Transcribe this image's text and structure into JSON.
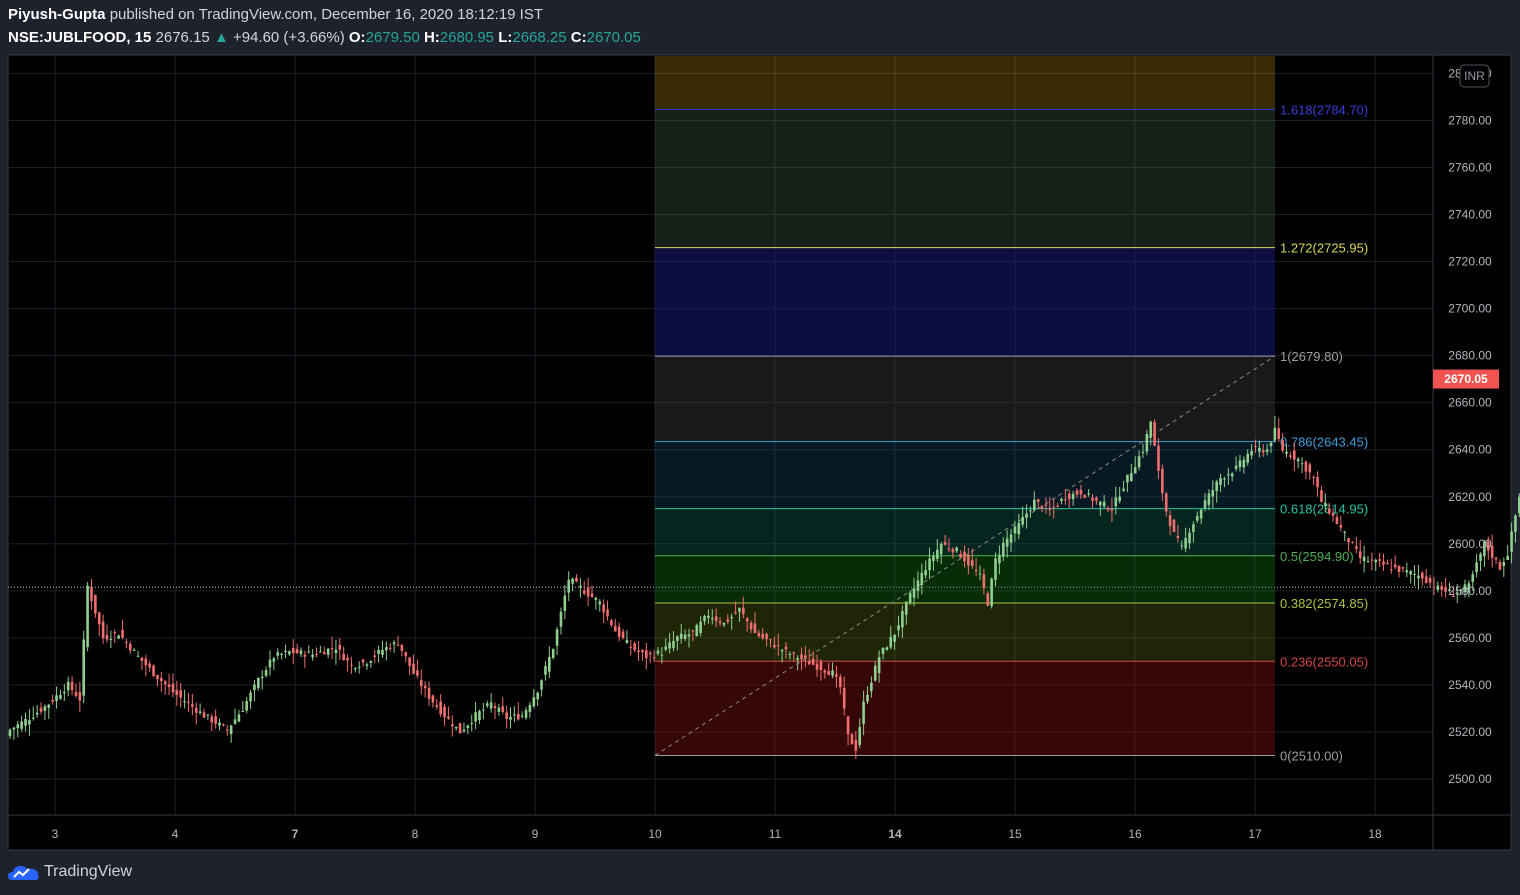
{
  "header": {
    "author": "Piyush-Gupta",
    "published_text": "published on TradingView.com, December 16, 2020 18:12:19 IST",
    "symbol": "NSE:JUBLFOOD, 15",
    "last": "2676.15",
    "change": "+94.60 (+3.66%)",
    "o_label": "O:",
    "o_value": "2679.50",
    "h_label": "H:",
    "h_value": "2680.95",
    "l_label": "L:",
    "l_value": "2668.25",
    "c_label": "C:",
    "c_value": "2670.05"
  },
  "currency_badge": "INR",
  "price_badge": "2670.05",
  "footer": {
    "brand": "TradingView"
  },
  "colors": {
    "up": "#26a69a",
    "down": "#ef5350",
    "upCandle": "#8fcf8f",
    "downCandle": "#f06e6e",
    "price_badge": "#f05350"
  },
  "chart_data": {
    "type": "candlestick",
    "title": "NSE:JUBLFOOD, 15",
    "xlabel": "",
    "ylabel": "",
    "ylim": [
      2490,
      2810
    ],
    "x_ticks": [
      "3",
      "4",
      "7",
      "8",
      "9",
      "10",
      "11",
      "14",
      "15",
      "16",
      "17",
      "18"
    ],
    "y_ticks": [
      "2500.00",
      "2520.00",
      "2540.00",
      "2560.00",
      "2580.00",
      "2600.00",
      "2620.00",
      "2640.00",
      "2660.00",
      "2680.00",
      "2700.00",
      "2720.00",
      "2740.00",
      "2760.00",
      "2780.00",
      "2800.00"
    ],
    "last_price": 2670.05,
    "prev_close_line": 2581.5,
    "grid": true,
    "fibonacci": {
      "from": {
        "x": "10",
        "y": 2510.0
      },
      "to": {
        "x": "17",
        "y": 2679.8
      },
      "levels": [
        {
          "ratio": "1.618",
          "price": "2784.70",
          "label": "1.618(2784.70)",
          "color": "#3b3bd9"
        },
        {
          "ratio": "1.272",
          "price": "2725.95",
          "label": "1.272(2725.95)",
          "color": "#d6d95a"
        },
        {
          "ratio": "1",
          "price": "2679.80",
          "label": "1(2679.80)",
          "color": "#9e9e9e"
        },
        {
          "ratio": "0.786",
          "price": "2643.45",
          "label": "0.786(2643.45)",
          "color": "#3c9fd9"
        },
        {
          "ratio": "0.618",
          "price": "2614.95",
          "label": "0.618(2614.95)",
          "color": "#27c4a3"
        },
        {
          "ratio": "0.5",
          "price": "2594.90",
          "label": "0.5(2594.90)",
          "color": "#4caf50"
        },
        {
          "ratio": "0.382",
          "price": "2574.85",
          "label": "0.382(2574.85)",
          "color": "#b0c23c"
        },
        {
          "ratio": "0.236",
          "price": "2550.05",
          "label": "0.236(2550.05)",
          "color": "#d34545"
        },
        {
          "ratio": "0",
          "price": "2510.00",
          "label": "0(2510.00)",
          "color": "#9e9e9e"
        }
      ]
    },
    "close_path": [
      [
        0,
        2521
      ],
      [
        5,
        2526
      ],
      [
        10,
        2532
      ],
      [
        15,
        2540
      ],
      [
        18,
        2534
      ],
      [
        20,
        2582
      ],
      [
        24,
        2560
      ],
      [
        28,
        2562
      ],
      [
        33,
        2552
      ],
      [
        37,
        2545
      ],
      [
        42,
        2537
      ],
      [
        46,
        2532
      ],
      [
        50,
        2527
      ],
      [
        56,
        2521
      ],
      [
        60,
        2530
      ],
      [
        64,
        2542
      ],
      [
        68,
        2552
      ],
      [
        72,
        2554
      ],
      [
        78,
        2553
      ],
      [
        84,
        2556
      ],
      [
        88,
        2548
      ],
      [
        92,
        2550
      ],
      [
        96,
        2555
      ],
      [
        100,
        2558
      ],
      [
        104,
        2545
      ],
      [
        108,
        2535
      ],
      [
        112,
        2527
      ],
      [
        116,
        2520
      ],
      [
        120,
        2527
      ],
      [
        124,
        2532
      ],
      [
        128,
        2526
      ],
      [
        132,
        2527
      ],
      [
        136,
        2538
      ],
      [
        140,
        2556
      ],
      [
        144,
        2585
      ],
      [
        148,
        2580
      ],
      [
        152,
        2575
      ],
      [
        156,
        2563
      ],
      [
        160,
        2556
      ],
      [
        164,
        2552
      ],
      [
        168,
        2554
      ],
      [
        172,
        2560
      ],
      [
        176,
        2562
      ],
      [
        180,
        2570
      ],
      [
        184,
        2566
      ],
      [
        188,
        2572
      ],
      [
        192,
        2562
      ],
      [
        196,
        2558
      ],
      [
        200,
        2554
      ],
      [
        204,
        2551
      ],
      [
        208,
        2548
      ],
      [
        212,
        2545
      ],
      [
        214,
        2539
      ],
      [
        216,
        2518
      ],
      [
        218,
        2513
      ],
      [
        220,
        2532
      ],
      [
        224,
        2552
      ],
      [
        228,
        2562
      ],
      [
        232,
        2578
      ],
      [
        236,
        2590
      ],
      [
        240,
        2600
      ],
      [
        244,
        2597
      ],
      [
        248,
        2590
      ],
      [
        250,
        2586
      ],
      [
        252,
        2575
      ],
      [
        254,
        2593
      ],
      [
        256,
        2600
      ],
      [
        260,
        2608
      ],
      [
        264,
        2618
      ],
      [
        268,
        2614
      ],
      [
        272,
        2620
      ],
      [
        276,
        2622
      ],
      [
        280,
        2618
      ],
      [
        284,
        2615
      ],
      [
        288,
        2628
      ],
      [
        292,
        2640
      ],
      [
        294,
        2652
      ],
      [
        296,
        2630
      ],
      [
        298,
        2614
      ],
      [
        300,
        2604
      ],
      [
        302,
        2598
      ],
      [
        304,
        2606
      ],
      [
        308,
        2618
      ],
      [
        312,
        2628
      ],
      [
        316,
        2632
      ],
      [
        320,
        2640
      ],
      [
        324,
        2640
      ],
      [
        326,
        2648
      ],
      [
        328,
        2640
      ],
      [
        332,
        2636
      ],
      [
        336,
        2628
      ],
      [
        338,
        2618
      ],
      [
        340,
        2614
      ],
      [
        344,
        2604
      ],
      [
        348,
        2594
      ],
      [
        352,
        2592
      ],
      [
        356,
        2590
      ],
      [
        360,
        2588
      ],
      [
        364,
        2586
      ],
      [
        368,
        2581
      ],
      [
        372,
        2579
      ],
      [
        376,
        2582
      ],
      [
        380,
        2600
      ],
      [
        384,
        2590
      ],
      [
        386,
        2596
      ],
      [
        388,
        2612
      ],
      [
        390,
        2628
      ],
      [
        392,
        2640
      ],
      [
        396,
        2640
      ],
      [
        400,
        2638
      ],
      [
        404,
        2633
      ],
      [
        405,
        2628
      ],
      [
        408,
        2652
      ],
      [
        410,
        2675
      ],
      [
        412,
        2680
      ],
      [
        416,
        2678
      ],
      [
        420,
        2672
      ]
    ]
  }
}
